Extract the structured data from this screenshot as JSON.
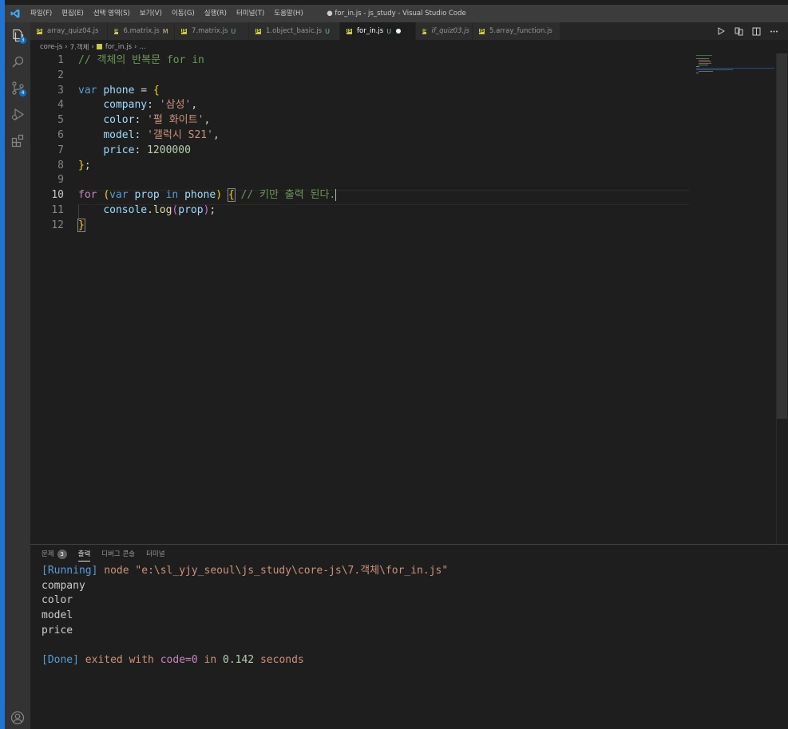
{
  "window": {
    "title": "● for_in.js - js_study - Visual Studio Code",
    "menu": [
      "파일(F)",
      "편집(E)",
      "선택 영역(S)",
      "보기(V)",
      "이동(G)",
      "실행(R)",
      "터미널(T)",
      "도움말(H)"
    ]
  },
  "activitybar": {
    "explorer_badge": "3",
    "scm_badge": "4"
  },
  "tabs": [
    {
      "label": "array_quiz04.js",
      "status": "",
      "active": false,
      "italic": false,
      "dirty": false
    },
    {
      "label": "6.matrix.js",
      "status": "M",
      "active": false,
      "italic": false,
      "dirty": false
    },
    {
      "label": "7.matrix.js",
      "status": "U",
      "active": false,
      "italic": false,
      "dirty": false
    },
    {
      "label": "1.object_basic.js",
      "status": "U",
      "active": false,
      "italic": false,
      "dirty": false
    },
    {
      "label": "for_in.js",
      "status": "U",
      "active": true,
      "italic": false,
      "dirty": true
    },
    {
      "label": "if_quiz03.js",
      "status": "",
      "active": false,
      "italic": true,
      "dirty": false
    },
    {
      "label": "5.array_function.js",
      "status": "",
      "active": false,
      "italic": false,
      "dirty": false
    }
  ],
  "breadcrumb": {
    "root": "core-js",
    "folder": "7.객체",
    "file": "for_in.js",
    "more": "..."
  },
  "editor": {
    "current_line": 10,
    "lines": [
      {
        "n": "1",
        "tokens": [
          [
            "tk-comment",
            "// 객체의 반복문 for in"
          ]
        ]
      },
      {
        "n": "2",
        "tokens": []
      },
      {
        "n": "3",
        "tokens": [
          [
            "tk-kw",
            "var"
          ],
          [
            "tk-plain",
            " "
          ],
          [
            "tk-var",
            "phone"
          ],
          [
            "tk-plain",
            " = "
          ],
          [
            "tk-brace",
            "{"
          ]
        ]
      },
      {
        "n": "4",
        "tokens": [
          [
            "tk-plain",
            "    "
          ],
          [
            "tk-prop",
            "company"
          ],
          [
            "tk-plain",
            ": "
          ],
          [
            "tk-str",
            "'삼성'"
          ],
          [
            "tk-plain",
            ","
          ]
        ]
      },
      {
        "n": "5",
        "tokens": [
          [
            "tk-plain",
            "    "
          ],
          [
            "tk-prop",
            "color"
          ],
          [
            "tk-plain",
            ": "
          ],
          [
            "tk-str",
            "'펄 화이트'"
          ],
          [
            "tk-plain",
            ","
          ]
        ]
      },
      {
        "n": "6",
        "tokens": [
          [
            "tk-plain",
            "    "
          ],
          [
            "tk-prop",
            "model"
          ],
          [
            "tk-plain",
            ": "
          ],
          [
            "tk-str",
            "'갤럭시 S21'"
          ],
          [
            "tk-plain",
            ","
          ]
        ]
      },
      {
        "n": "7",
        "tokens": [
          [
            "tk-plain",
            "    "
          ],
          [
            "tk-prop",
            "price"
          ],
          [
            "tk-plain",
            ": "
          ],
          [
            "tk-num",
            "1200000"
          ]
        ]
      },
      {
        "n": "8",
        "tokens": [
          [
            "tk-brace",
            "}"
          ],
          [
            "tk-plain",
            ";"
          ]
        ]
      },
      {
        "n": "9",
        "tokens": []
      },
      {
        "n": "10",
        "tokens": [
          [
            "tk-ctrl",
            "for"
          ],
          [
            "tk-plain",
            " "
          ],
          [
            "tk-brace",
            "("
          ],
          [
            "tk-kw",
            "var"
          ],
          [
            "tk-plain",
            " "
          ],
          [
            "tk-var",
            "prop"
          ],
          [
            "tk-plain",
            " "
          ],
          [
            "tk-kw",
            "in"
          ],
          [
            "tk-plain",
            " "
          ],
          [
            "tk-var",
            "phone"
          ],
          [
            "tk-brace",
            ")"
          ],
          [
            "tk-plain",
            " "
          ],
          [
            "tk-brace bracket-box",
            "{"
          ],
          [
            "tk-plain",
            " "
          ],
          [
            "tk-comment",
            "// 키만 출력 된다."
          ],
          [
            "cursor",
            ""
          ]
        ]
      },
      {
        "n": "11",
        "tokens": [
          [
            "tk-plain",
            "    "
          ],
          [
            "tk-var",
            "console"
          ],
          [
            "tk-plain",
            "."
          ],
          [
            "tk-fn",
            "log"
          ],
          [
            "tk-paren",
            "("
          ],
          [
            "tk-var",
            "prop"
          ],
          [
            "tk-paren",
            ")"
          ],
          [
            "tk-plain",
            ";"
          ]
        ]
      },
      {
        "n": "12",
        "tokens": [
          [
            "tk-brace bracket-box",
            "}"
          ]
        ]
      }
    ]
  },
  "panel": {
    "tabs": [
      {
        "label": "문제",
        "count": "3",
        "active": false
      },
      {
        "label": "출력",
        "count": "",
        "active": true
      },
      {
        "label": "디버그 콘솔",
        "count": "",
        "active": false
      },
      {
        "label": "터미널",
        "count": "",
        "active": false
      }
    ],
    "output": {
      "running_tag": "[Running]",
      "running_cmd": " node \"e:\\sl_yjy_seoul\\js_study\\core-js\\7.객체\\for_in.js\"",
      "lines": [
        "company",
        "color",
        "model",
        "price",
        ""
      ],
      "done_tag": "[Done]",
      "done_text1": " exited with ",
      "done_code": "code=0",
      "done_text2": " in ",
      "done_time": "0.142",
      "done_text3": " seconds"
    }
  },
  "colors": {
    "accent": "#1f74d4",
    "titlebar": "#3c3c3c",
    "activitybar": "#333333",
    "editor_bg": "#1e1e1e"
  }
}
